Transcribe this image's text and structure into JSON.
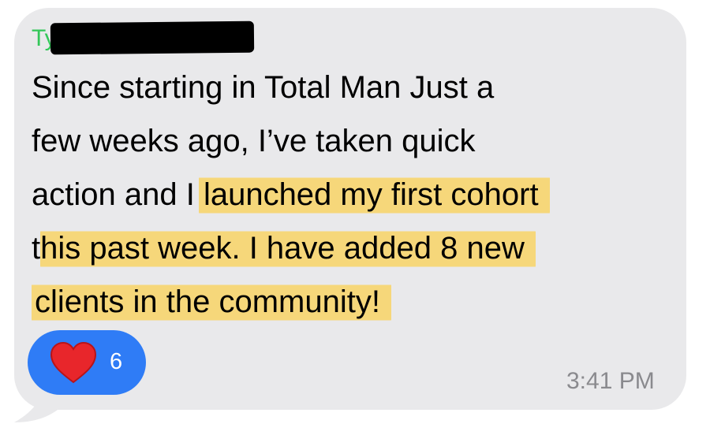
{
  "message": {
    "sender_visible": "Ty",
    "lines": [
      {
        "plain": "Since starting in Total Man Just a",
        "highlight": ""
      },
      {
        "plain": "few weeks ago, I’ve taken quick",
        "highlight": ""
      },
      {
        "plain": "action and I ",
        "highlight": "launched my first cohort"
      },
      {
        "plain": "t",
        "highlight": "his past week.  I have added 8 new"
      },
      {
        "plain": "",
        "highlight": "clients in the community!"
      }
    ],
    "timestamp": "3:41 PM"
  },
  "reaction": {
    "icon": "heart-icon",
    "count": "6"
  },
  "colors": {
    "bubble": "#e9e9eb",
    "sender": "#34c759",
    "highlight": "#f6d77a",
    "reaction_bg": "#2f7cf6",
    "heart": "#e8262b"
  }
}
